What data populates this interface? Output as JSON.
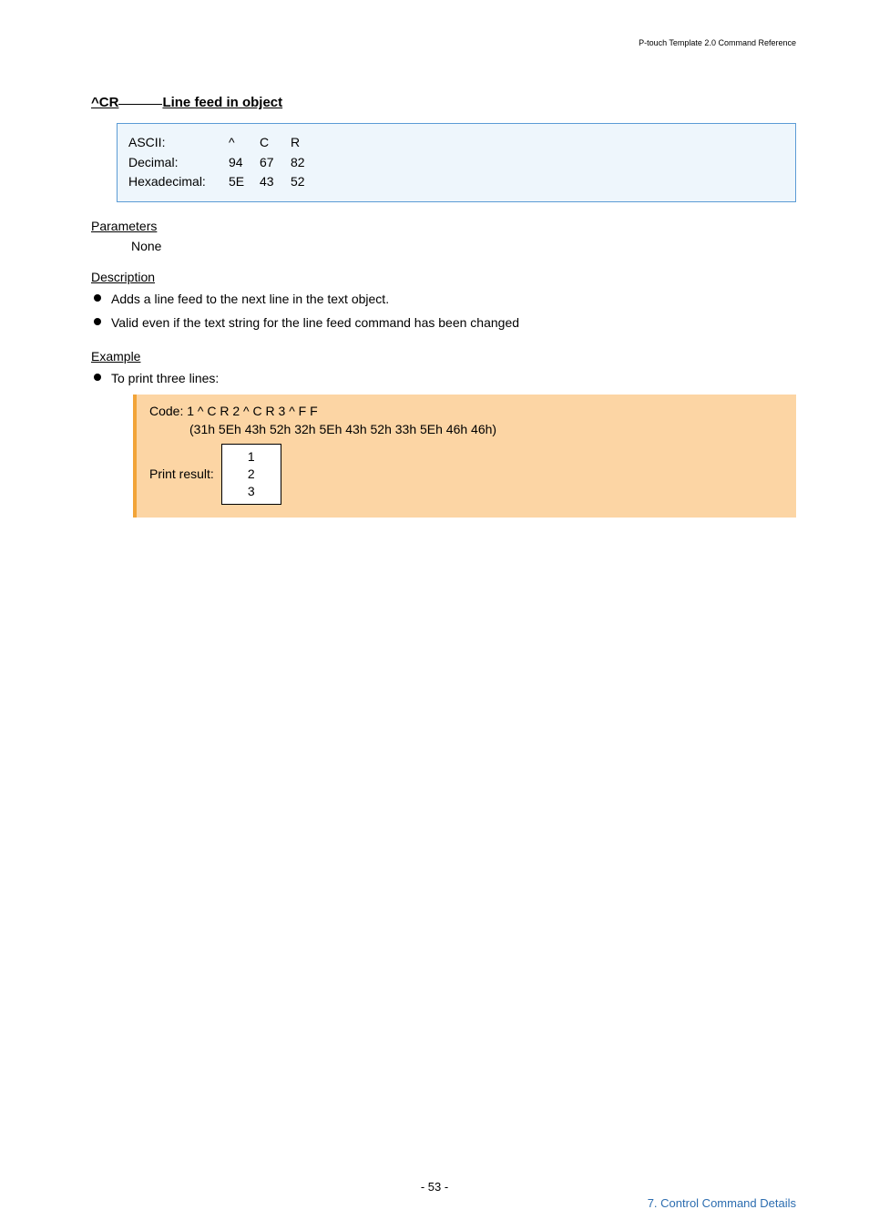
{
  "header": {
    "doc_title": "P-touch Template 2.0 Command Reference"
  },
  "section": {
    "command": "^CR",
    "title": "Line feed in object"
  },
  "codebox": {
    "rows": [
      {
        "label": "ASCII:",
        "c1": "^",
        "c2": "C",
        "c3": "R"
      },
      {
        "label": "Decimal:",
        "c1": "94",
        "c2": "67",
        "c3": "82"
      },
      {
        "label": "Hexadecimal:",
        "c1": "5E",
        "c2": "43",
        "c3": "52"
      }
    ]
  },
  "parameters": {
    "heading": "Parameters",
    "text": "None"
  },
  "description": {
    "heading": "Description",
    "bullets": [
      "Adds a line feed to the next line in the text object.",
      "Valid even if the text string for the line feed command has been changed"
    ]
  },
  "example": {
    "heading": "Example",
    "intro_bullet": "To print three lines:",
    "code_line": "Code: 1 ^ C R 2 ^ C R 3 ^ F F",
    "hex_line": "(31h 5Eh 43h 52h 32h 5Eh 43h 52h 33h 5Eh 46h 46h)",
    "print_label": "Print result:",
    "print_lines": [
      "1",
      "2",
      "3"
    ]
  },
  "footer": {
    "page_number": "- 53 -",
    "right": "7. Control Command Details"
  }
}
